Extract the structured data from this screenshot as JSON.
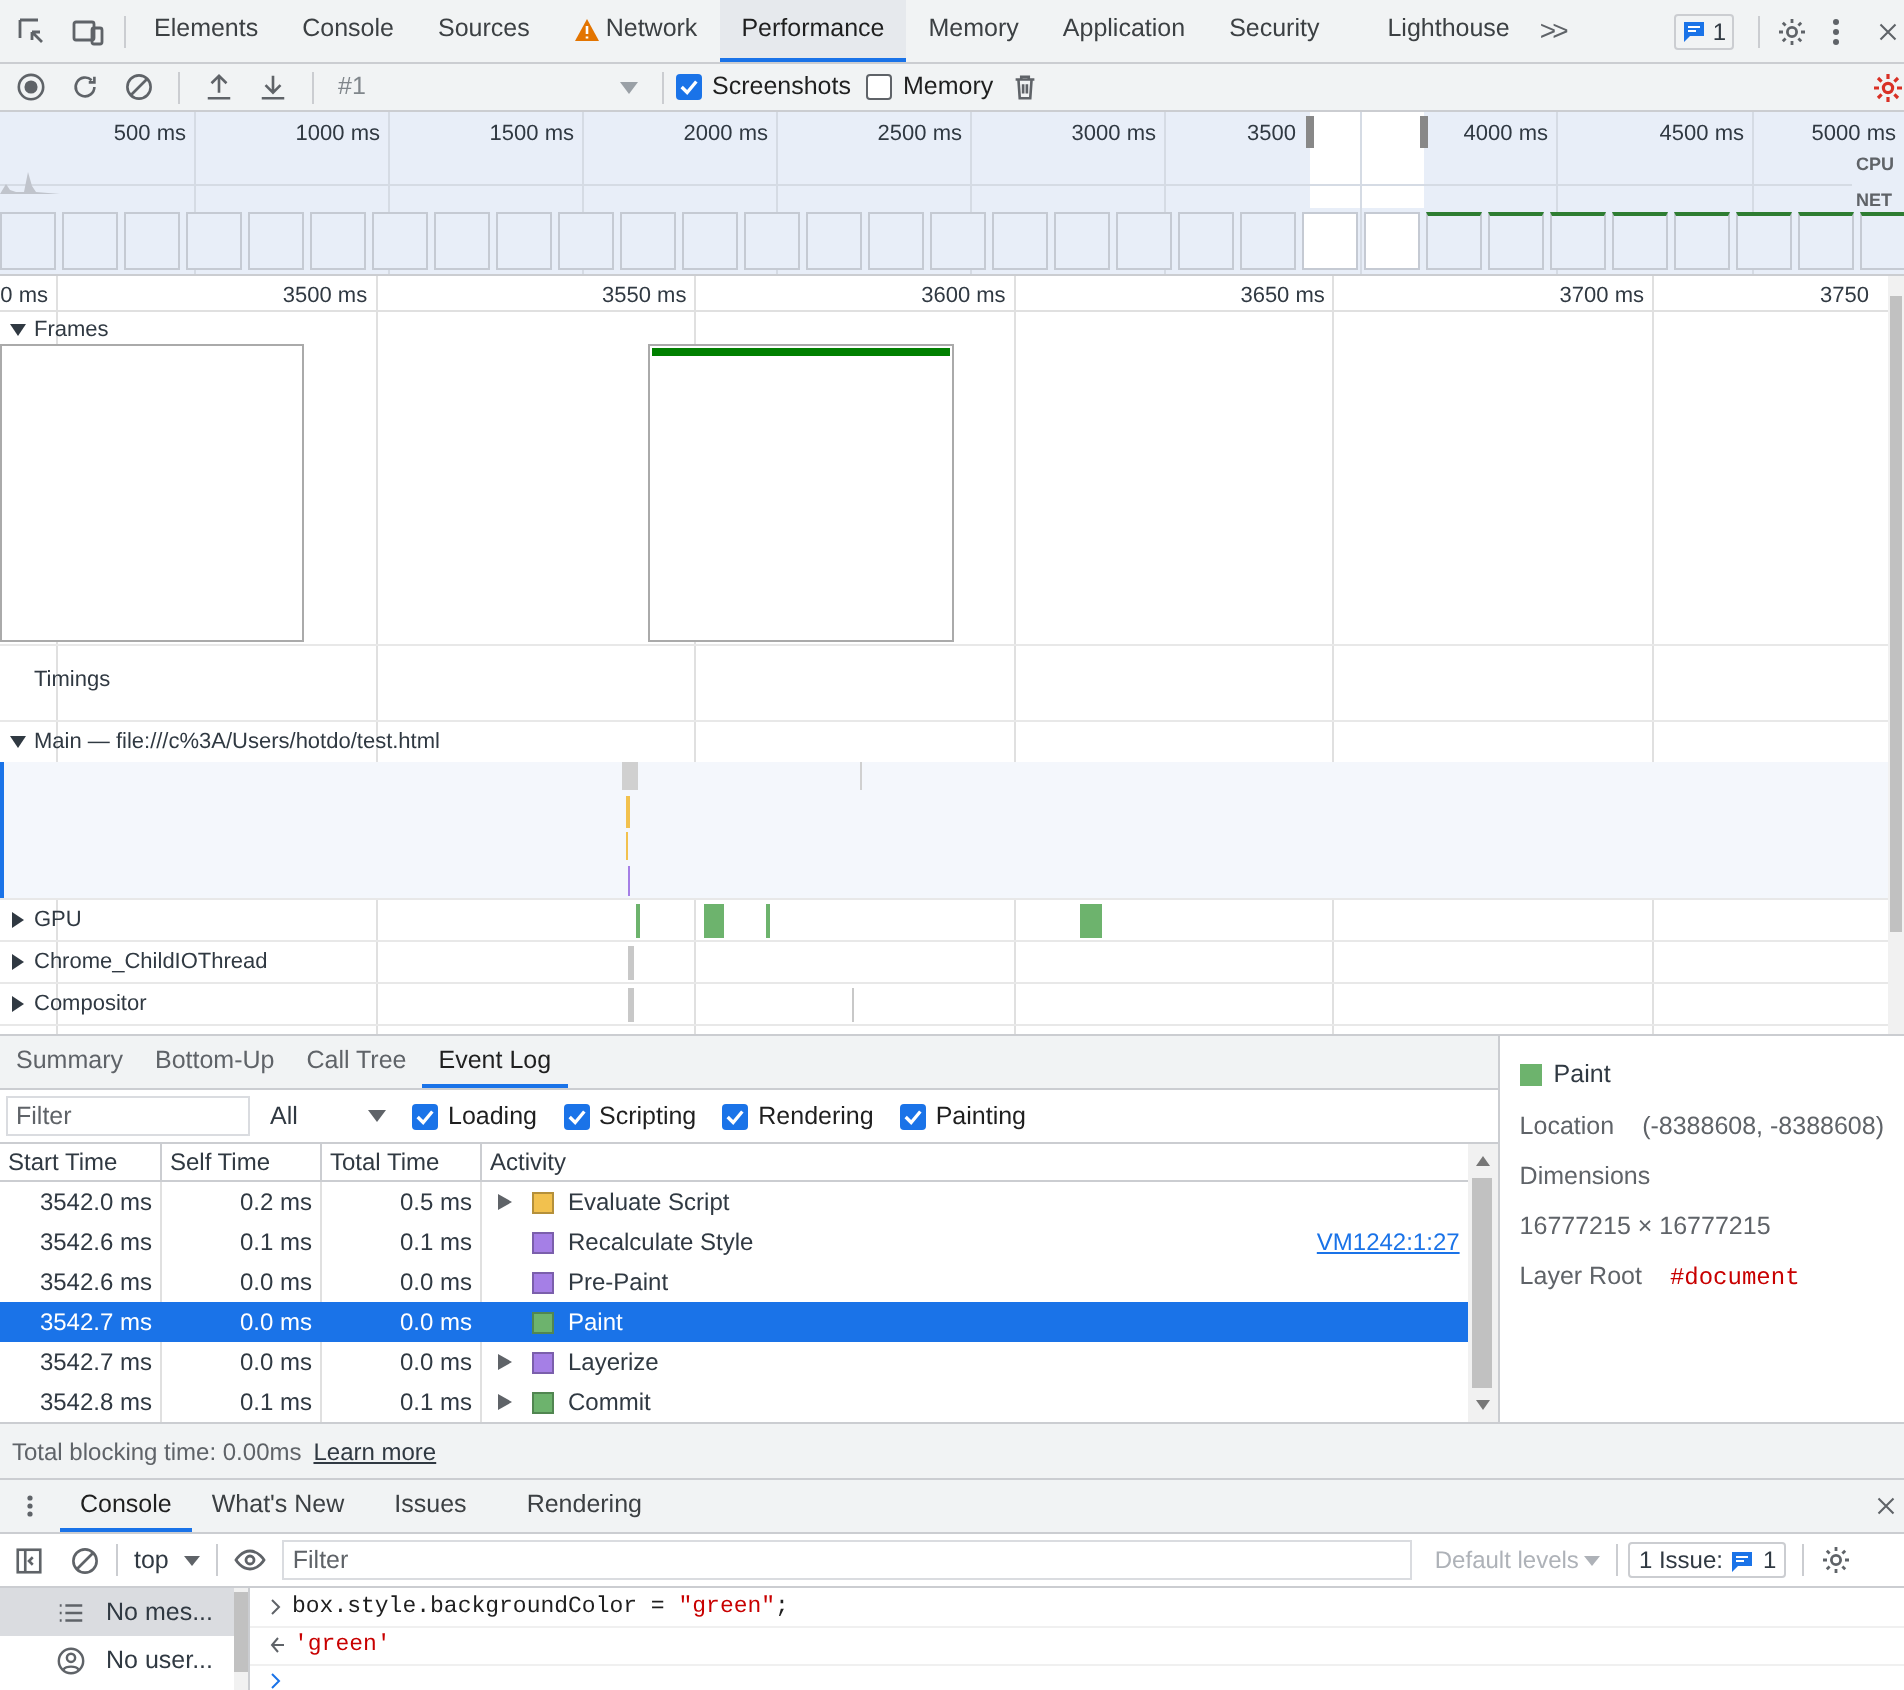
{
  "tabs": [
    {
      "label": "Elements",
      "selected": false,
      "warning": false
    },
    {
      "label": "Console",
      "selected": false,
      "warning": false
    },
    {
      "label": "Sources",
      "selected": false,
      "warning": false
    },
    {
      "label": "Network",
      "selected": false,
      "warning": true
    },
    {
      "label": "Performance",
      "selected": true,
      "warning": false
    },
    {
      "label": "Memory",
      "selected": false,
      "warning": false
    },
    {
      "label": "Application",
      "selected": false,
      "warning": false
    },
    {
      "label": "Security",
      "selected": false,
      "warning": false
    },
    {
      "label": "Lighthouse",
      "selected": false,
      "warning": false
    }
  ],
  "more_tabs": ">>",
  "issues_count": "1",
  "toolbar": {
    "recording": "#1",
    "checkboxes": [
      {
        "label": "Screenshots",
        "checked": true
      },
      {
        "label": "Memory",
        "checked": false
      }
    ]
  },
  "overview": {
    "ticks": [
      "500 ms",
      "1000 ms",
      "1500 ms",
      "2000 ms",
      "2500 ms",
      "3000 ms",
      "3500",
      "4000 ms",
      "4500 ms",
      "5000 ms"
    ],
    "lanes": [
      "CPU",
      "NET"
    ]
  },
  "ruler": [
    "0 ms",
    "3500 ms",
    "3550 ms",
    "3600 ms",
    "3650 ms",
    "3700 ms",
    "3750"
  ],
  "tracks": [
    {
      "kind": "frames",
      "label": "Frames",
      "expanded": true
    },
    {
      "kind": "timings",
      "label": "Timings"
    },
    {
      "kind": "main",
      "label": "Main — file:///c%3A/Users/hotdo/test.html",
      "expanded": true
    },
    {
      "kind": "gpu",
      "label": "GPU",
      "expanded": false
    },
    {
      "kind": "thread",
      "label": "Chrome_ChildIOThread",
      "expanded": false
    },
    {
      "kind": "thread",
      "label": "Compositor",
      "expanded": false
    }
  ],
  "details_tabs": [
    {
      "label": "Summary",
      "selected": false
    },
    {
      "label": "Bottom-Up",
      "selected": false
    },
    {
      "label": "Call Tree",
      "selected": false
    },
    {
      "label": "Event Log",
      "selected": true
    }
  ],
  "filter": {
    "placeholder": "Filter",
    "dropdown": "All",
    "checkboxes": [
      {
        "label": "Loading",
        "checked": true
      },
      {
        "label": "Scripting",
        "checked": true
      },
      {
        "label": "Rendering",
        "checked": true
      },
      {
        "label": "Painting",
        "checked": true
      }
    ]
  },
  "table": {
    "columns": [
      "Start Time",
      "Self Time",
      "Total Time",
      "Activity"
    ],
    "rows": [
      {
        "start": "3542.0 ms",
        "self": "0.2 ms",
        "total": "0.5 ms",
        "activity": "Evaluate Script",
        "color": "#f2c14e",
        "has_children": true,
        "selected": false
      },
      {
        "start": "3542.6 ms",
        "self": "0.1 ms",
        "total": "0.1 ms",
        "activity": "Recalculate Style",
        "color": "#a57fe6",
        "has_children": false,
        "link": "VM1242:1:27",
        "selected": false
      },
      {
        "start": "3542.6 ms",
        "self": "0.0 ms",
        "total": "0.0 ms",
        "activity": "Pre-Paint",
        "color": "#a57fe6",
        "has_children": false,
        "selected": false
      },
      {
        "start": "3542.7 ms",
        "self": "0.0 ms",
        "total": "0.0 ms",
        "activity": "Paint",
        "color": "#6db36d",
        "has_children": false,
        "selected": true
      },
      {
        "start": "3542.7 ms",
        "self": "0.0 ms",
        "total": "0.0 ms",
        "activity": "Layerize",
        "color": "#a57fe6",
        "has_children": true,
        "selected": false
      },
      {
        "start": "3542.8 ms",
        "self": "0.1 ms",
        "total": "0.1 ms",
        "activity": "Commit",
        "color": "#6db36d",
        "has_children": true,
        "selected": false
      }
    ]
  },
  "summary": {
    "title": "Paint",
    "color": "#6db36d",
    "fields": [
      {
        "label": "Location",
        "value": "(-8388608, -8388608)"
      },
      {
        "label": "Dimensions"
      },
      {
        "value": "16777215 × 16777215"
      },
      {
        "label": "Layer Root",
        "value": "#document"
      }
    ]
  },
  "footer": {
    "text": "Total blocking time: 0.00ms",
    "link": "Learn more"
  },
  "drawer_tabs": [
    {
      "label": "Console",
      "selected": true
    },
    {
      "label": "What's New",
      "selected": false
    },
    {
      "label": "Issues",
      "selected": false
    },
    {
      "label": "Rendering",
      "selected": false
    }
  ],
  "console_toolbar": {
    "context": "top",
    "filter_placeholder": "Filter",
    "levels": "Default levels",
    "issues": "1 Issue:",
    "issues_count": "1"
  },
  "console_sidebar": [
    {
      "label": "No mes...",
      "selected": true
    },
    {
      "label": "No user...",
      "selected": false
    }
  ],
  "console_lines": [
    {
      "kind": "input",
      "code": "box.style.backgroundColor =",
      "string": "\"green\"",
      "rest": ";"
    },
    {
      "kind": "result",
      "string": "'green'"
    }
  ]
}
